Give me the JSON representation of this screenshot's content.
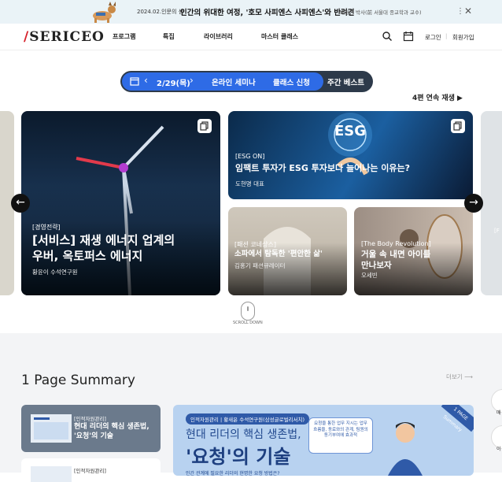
{
  "banner": {
    "date": "2024.02.인문의 샘",
    "headline": "인간의 위대한 여정, '호모 사피엔스 사피엔스'와 반려견",
    "sub": "배정현 박사(前 서울대 종교학과 교수)",
    "dots": "⋮",
    "close": "✕"
  },
  "header": {
    "logo": "SERICEO",
    "nav": [
      "프로그램",
      "특집",
      "라이브러리",
      "마스터 클래스"
    ],
    "login": "로그인",
    "separator": "|",
    "signup": "회원가입"
  },
  "filter": {
    "date": "2/29(목)",
    "prev": "‹",
    "next": "›",
    "items": [
      "온라인 세미나",
      "클래스 신청",
      "주간 베스트"
    ]
  },
  "series_play": "4편 연속 재생 ▶",
  "cards": [
    {
      "cat": "[경영전략]",
      "title": "[서비스] 재생 에너지 업계의\n우버, 옥토퍼스 에너지",
      "author": "황윤이 수석연구원"
    },
    {
      "cat": "[ESG ON]",
      "title": "임팩트 투자가 ESG 투자보다 늘어나는 이유는?",
      "author": "도현명 대표",
      "overlay": "ESG"
    },
    {
      "cat": "[패션 코네상스]",
      "title": "소파에서 탐독한 '편안한 삶'",
      "author": "김홍기 패션큐레이터"
    },
    {
      "cat": "[The Body Revolution]",
      "title": "거울 속 내면 아이를\n만나보자",
      "author": "오세빈"
    }
  ],
  "side_right_partial": "[F",
  "arrows": {
    "left": "←",
    "right": "→"
  },
  "scroll_label": "SCROLL DOWN",
  "summary": {
    "title": "1 Page Summary",
    "more": "더보기 ⟶",
    "items": [
      {
        "cat": "[인적자원관리]",
        "title": "현대 리더의 핵심 생존법, '요청'의 기술"
      },
      {
        "cat": "[인적자원관리]",
        "title": ""
      }
    ],
    "feature": {
      "tag": "인적자원관리 | 황새윤 수석연구원(삼성글로벌리서치)",
      "line1": "현대 리더의 핵심 생존법,",
      "line2a": "'요청'",
      "line2b": "의 기술",
      "bubble": "요청을 통한 업무 지시는 업무 흐름을, 동료와의 관계, 팀원의 동기부여에 효과적",
      "ribbon": "1 PAGE Summary",
      "caption": "인간 관계에 필요한 리더의 현명한 요청 방법은?"
    }
  },
  "float_buttons": [
    "매",
    "이"
  ],
  "colors": {
    "accent": "#2e6be6",
    "pill": "#2d3a4a",
    "logo_red": "#d6202a",
    "summary_bg": "#f3f4f6"
  }
}
